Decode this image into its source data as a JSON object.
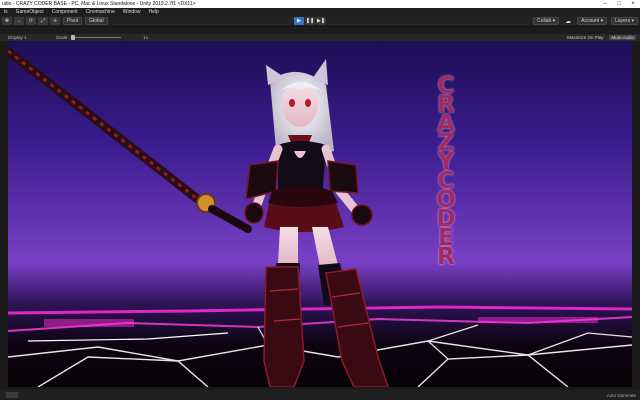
{
  "window": {
    "title": "udio - CRAZY CODER BASE - PC, Mac & Linux Standalone - Unity 2019.2.7f1 <DX11>",
    "controls": [
      "–",
      "□",
      "×"
    ]
  },
  "menu": {
    "items": [
      "ls",
      "GameObject",
      "Component",
      "Cinemachine",
      "Window",
      "Help"
    ]
  },
  "toolbar": {
    "tools": [
      "✥",
      "↔",
      "⟳",
      "⤢",
      "✛"
    ],
    "pivot": "Pivot",
    "global": "Global",
    "play": "▶",
    "pause": "❚❚",
    "step": "▶❚",
    "collab": "Collab ▾",
    "account": "Account ▾",
    "layers": "Layers ▾",
    "cloud": "☁"
  },
  "game_view": {
    "display_label": "Display 1",
    "scale_label": "Scale",
    "scale_value": "1x",
    "maximize_on_play": "Maximize On Play",
    "mute_audio": "Mute Audio"
  },
  "scene": {
    "vertical_text": [
      "C",
      "R",
      "A",
      "Z",
      "Y",
      "C",
      "O",
      "D",
      "E",
      "R"
    ],
    "text_color": "#a12a64",
    "neon_color": "#ff2bd9",
    "sky_top": "#1d0f55",
    "sky_horizon": "#7a40c6"
  },
  "status": {
    "auto_generate": "Auto Generate"
  }
}
